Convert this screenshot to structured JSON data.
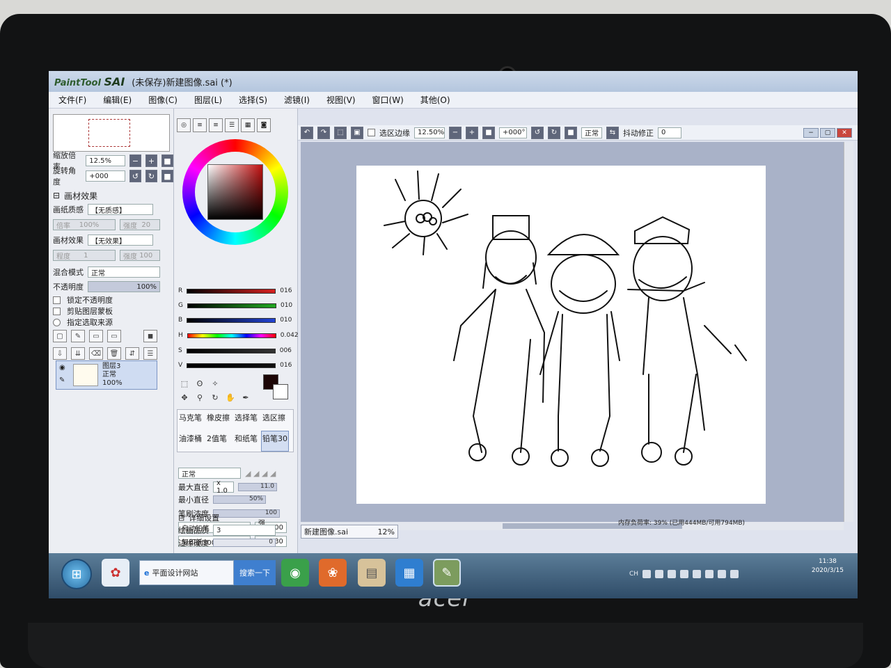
{
  "brand": "acer",
  "app": {
    "logo_text": "PaintTool",
    "logo_bold": "SAI",
    "window_title": "(未保存)新建图像.sai (*)"
  },
  "menu": [
    "文件(F)",
    "编辑(E)",
    "图像(C)",
    "图层(L)",
    "选择(S)",
    "滤镜(I)",
    "视图(V)",
    "窗口(W)",
    "其他(O)"
  ],
  "navigator": {
    "zoom_label": "缩放倍率",
    "zoom_value": "12.5%",
    "rotate_label": "旋转角度",
    "rotate_value": "+000"
  },
  "texture": {
    "section": "画材效果",
    "paper_label": "画纸质感",
    "paper_value": "【无质感】",
    "ratio_label": "倍率",
    "ratio_value": "100%",
    "strength_label": "强度",
    "strength_value": "20",
    "effect_label": "画材效果",
    "effect_value": "【无效果】",
    "degree_label": "程度",
    "degree_value": "1",
    "strength2_label": "强度",
    "strength2_value": "100"
  },
  "blend": {
    "mode_label": "混合模式",
    "mode_value": "正常",
    "opacity_label": "不透明度",
    "opacity_value": "100%",
    "lock_opacity": "锁定不透明度",
    "clip_mask": "剪贴图层蒙板",
    "select_source": "指定选取来源"
  },
  "layer": {
    "name": "图层3",
    "mode": "正常",
    "opacity": "100%"
  },
  "sliders": [
    {
      "label": "R",
      "value": "016",
      "color": "#d62020"
    },
    {
      "label": "G",
      "value": "010",
      "color": "#22a822"
    },
    {
      "label": "B",
      "value": "010",
      "color": "#2244d6"
    },
    {
      "label": "H",
      "value": "0.042",
      "color": "#d62020"
    },
    {
      "label": "S",
      "value": "006",
      "color": "#333333"
    },
    {
      "label": "V",
      "value": "016",
      "color": "#111111"
    }
  ],
  "brushes": [
    "马克笔",
    "橡皮擦",
    "选择笔",
    "选区擦",
    "油漆桶",
    "2值笔",
    "和纸笔",
    "铅笔30"
  ],
  "brush_params": {
    "mode_value": "正常",
    "max_size_label": "最大直径",
    "max_size_mult": "x 1.0",
    "max_size_value": "11.0",
    "min_size_label": "最小直径",
    "min_size_value": "50%",
    "density_label": "笔刷浓度",
    "density_value": "100",
    "shape_value": "自动铅笔",
    "shape_strength_label": "强度",
    "shape_strength_value": "100",
    "texture_value": "复印纸300",
    "texture_strength_label": "强度",
    "texture_strength_value": "30",
    "detail_label": "详细设置",
    "quality_label": "绘画品质",
    "quality_value": "3",
    "edge_label": "边缘硬度",
    "edge_value": "0"
  },
  "canvas_toolbar": {
    "selection_edge": "选区边缘",
    "zoom": "12.50%",
    "angle": "+000°",
    "blend": "正常",
    "stabilizer_label": "抖动修正",
    "stabilizer_value": "0"
  },
  "status": {
    "doc_name": "新建图像.sai",
    "doc_zoom": "12%",
    "memory": "内存负荷率: 39% (已用444MB/可用794MB)"
  },
  "taskbar": {
    "ie_label": "平面设计网站",
    "search_label": "搜索一下",
    "lang": "CH",
    "time": "11:38",
    "date": "2020/3/15"
  }
}
